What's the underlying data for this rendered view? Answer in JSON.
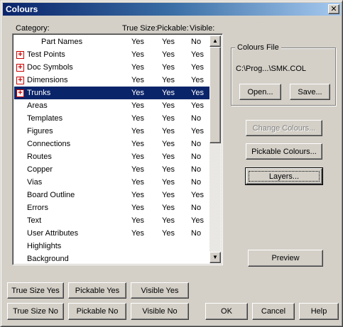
{
  "window": {
    "title": "Colours",
    "close_glyph": "✕"
  },
  "headers": {
    "category": "Category:",
    "true_size": "True Size:",
    "pickable": "Pickable:",
    "visible": "Visible:"
  },
  "rows": [
    {
      "name": "Part Names",
      "expandable": false,
      "centered": true,
      "true_size": "Yes",
      "pickable": "Yes",
      "visible": "No",
      "selected": false
    },
    {
      "name": "Test Points",
      "expandable": true,
      "true_size": "Yes",
      "pickable": "Yes",
      "visible": "Yes",
      "selected": false
    },
    {
      "name": "Doc Symbols",
      "expandable": true,
      "true_size": "Yes",
      "pickable": "Yes",
      "visible": "Yes",
      "selected": false
    },
    {
      "name": "Dimensions",
      "expandable": true,
      "true_size": "Yes",
      "pickable": "Yes",
      "visible": "Yes",
      "selected": false
    },
    {
      "name": "Trunks",
      "expandable": true,
      "true_size": "Yes",
      "pickable": "Yes",
      "visible": "Yes",
      "selected": true
    },
    {
      "name": "Areas",
      "expandable": false,
      "true_size": "Yes",
      "pickable": "Yes",
      "visible": "Yes",
      "selected": false
    },
    {
      "name": "Templates",
      "expandable": false,
      "true_size": "Yes",
      "pickable": "Yes",
      "visible": "No",
      "selected": false
    },
    {
      "name": "Figures",
      "expandable": false,
      "true_size": "Yes",
      "pickable": "Yes",
      "visible": "Yes",
      "selected": false
    },
    {
      "name": "Connections",
      "expandable": false,
      "true_size": "Yes",
      "pickable": "Yes",
      "visible": "No",
      "selected": false
    },
    {
      "name": "Routes",
      "expandable": false,
      "true_size": "Yes",
      "pickable": "Yes",
      "visible": "No",
      "selected": false
    },
    {
      "name": "Copper",
      "expandable": false,
      "true_size": "Yes",
      "pickable": "Yes",
      "visible": "No",
      "selected": false
    },
    {
      "name": "Vias",
      "expandable": false,
      "true_size": "Yes",
      "pickable": "Yes",
      "visible": "No",
      "selected": false
    },
    {
      "name": "Board Outline",
      "expandable": false,
      "true_size": "Yes",
      "pickable": "Yes",
      "visible": "Yes",
      "selected": false
    },
    {
      "name": "Errors",
      "expandable": false,
      "true_size": "Yes",
      "pickable": "Yes",
      "visible": "No",
      "selected": false
    },
    {
      "name": "Text",
      "expandable": false,
      "true_size": "Yes",
      "pickable": "Yes",
      "visible": "Yes",
      "selected": false
    },
    {
      "name": "User Attributes",
      "expandable": false,
      "true_size": "Yes",
      "pickable": "Yes",
      "visible": "No",
      "selected": false
    },
    {
      "name": "Highlights",
      "expandable": false,
      "true_size": "",
      "pickable": "",
      "visible": "",
      "selected": false
    },
    {
      "name": "Background",
      "expandable": false,
      "true_size": "",
      "pickable": "",
      "visible": "",
      "selected": false
    }
  ],
  "colours_file": {
    "label": "Colours File",
    "path": "C:\\Prog...\\SMK.COL",
    "open": "Open...",
    "save": "Save..."
  },
  "buttons": {
    "change_colours": "Change Colours...",
    "pickable_colours": "Pickable Colours...",
    "layers": "Layers...",
    "preview": "Preview",
    "true_size_yes": "True Size Yes",
    "pickable_yes": "Pickable Yes",
    "visible_yes": "Visible Yes",
    "true_size_no": "True Size No",
    "pickable_no": "Pickable No",
    "visible_no": "Visible No",
    "ok": "OK",
    "cancel": "Cancel",
    "help": "Help"
  },
  "icons": {
    "expand": "+",
    "scroll_up": "▲",
    "scroll_down": "▼"
  }
}
